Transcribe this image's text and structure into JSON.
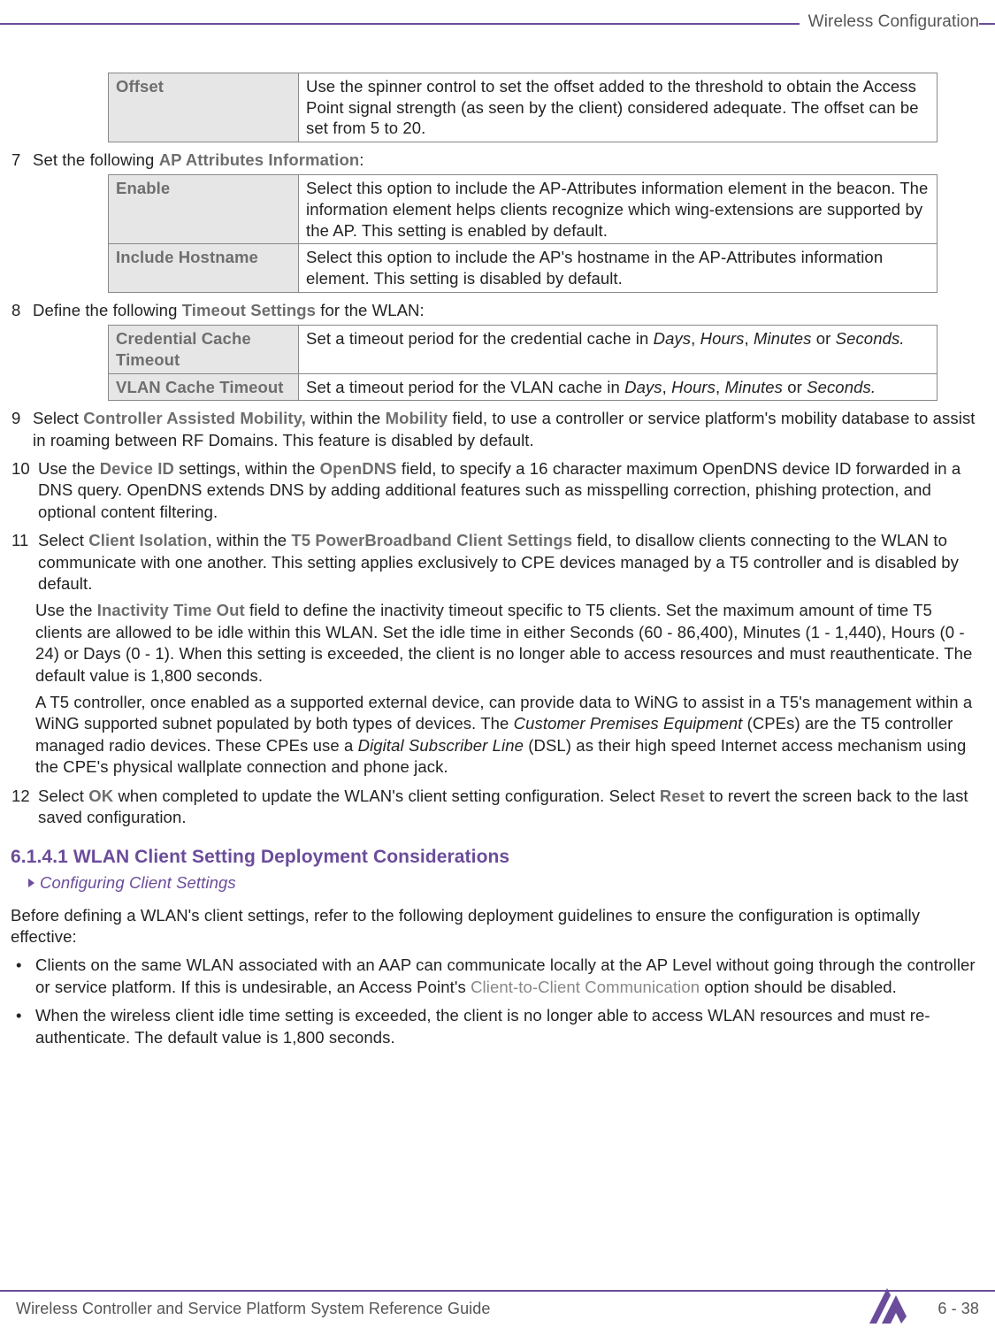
{
  "header": {
    "title": "Wireless Configuration"
  },
  "table_offset": {
    "rows": [
      {
        "label": "Offset",
        "desc": "Use the spinner control to set the offset added to the threshold to obtain the Access Point signal strength (as seen by the client) considered adequate. The offset can be set from 5 to 20."
      }
    ]
  },
  "step7": {
    "num": "7",
    "intro_pre": "Set the following ",
    "intro_bold": "AP Attributes Information",
    "intro_post": ":"
  },
  "table_ap": {
    "rows": [
      {
        "label": "Enable",
        "desc": "Select this option to include the AP-Attributes information element in the beacon. The information element helps clients recognize which wing-extensions are supported by the AP. This setting is enabled by default."
      },
      {
        "label": "Include Hostname",
        "desc": "Select this option to include the AP's hostname in the AP-Attributes information element. This setting is disabled by default."
      }
    ]
  },
  "step8": {
    "num": "8",
    "intro_pre": "Define the following ",
    "intro_bold": "Timeout Settings",
    "intro_post": " for the WLAN:"
  },
  "table_timeout": {
    "rows": [
      {
        "label": "Credential Cache Timeout",
        "desc_pre": "Set a timeout period for the credential cache in ",
        "i1": "Days",
        "s1": ", ",
        "i2": "Hours",
        "s2": ", ",
        "i3": "Minutes",
        "s3": " or ",
        "i4": "Seconds."
      },
      {
        "label": "VLAN Cache Timeout",
        "desc_pre": "Set a timeout period for the VLAN cache in ",
        "i1": "Days",
        "s1": ", ",
        "i2": "Hours",
        "s2": ", ",
        "i3": "Minutes",
        "s3": " or ",
        "i4": "Seconds."
      }
    ]
  },
  "step9": {
    "num": "9",
    "p1": "Select ",
    "b1": "Controller Assisted Mobility,",
    "p2": " within the ",
    "b2": "Mobility",
    "p3": " field, to use a controller or service platform's mobility database to assist in roaming between RF Domains. This feature is disabled by default."
  },
  "step10": {
    "num": "10",
    "p1": "Use the ",
    "b1": "Device ID",
    "p2": " settings, within the ",
    "b2": "OpenDNS",
    "p3": " field, to specify a 16 character maximum OpenDNS device ID forwarded in a DNS query. OpenDNS extends DNS by adding additional features such as misspelling correction, phishing protection, and optional content filtering."
  },
  "step11": {
    "num": "11",
    "p1": "Select ",
    "b1": "Client Isolation",
    "p2": ", within the ",
    "b2": "T5 PowerBroadband Client Settings",
    "p3": " field, to disallow clients connecting to the WLAN to communicate with one another. This setting applies exclusively to CPE devices managed by a T5 controller and is disabled by default.",
    "sub1_pre": "Use the ",
    "sub1_b": "Inactivity Time Out",
    "sub1_post": " field to define the inactivity timeout specific to T5 clients. Set the maximum amount of time T5 clients are allowed to be idle within this WLAN. Set the idle time in either Seconds (60 - 86,400), Minutes (1 - 1,440), Hours (0 - 24) or Days (0 - 1). When this setting is exceeded, the client is no longer able to access resources and must reauthenticate. The default value is 1,800 seconds.",
    "sub2_p1": "A T5 controller, once enabled as a supported external device, can provide data to WiNG to assist in a T5's management within a WiNG supported subnet populated by both types of devices. The ",
    "sub2_i1": "Customer Premises Equipment",
    "sub2_p2": " (CPEs) are the T5 controller managed radio devices. These CPEs use a ",
    "sub2_i2": "Digital Subscriber Line",
    "sub2_p3": " (DSL) as their high speed Internet access mechanism using the CPE's physical wallplate connection and phone jack."
  },
  "step12": {
    "num": "12",
    "p1": "Select ",
    "b1": "OK",
    "p2": " when completed to update the WLAN's client setting configuration. Select ",
    "b2": "Reset",
    "p3": " to revert the screen back to the last saved configuration."
  },
  "section_heading": "6.1.4.1 WLAN Client Setting Deployment Considerations",
  "breadcrumb": "Configuring Client Settings",
  "before_para": "Before defining a WLAN's client settings, refer to the following deployment guidelines to ensure the configuration is optimally effective:",
  "bullets": [
    {
      "p1": "Clients on the same WLAN associated with an AAP can communicate locally at the AP Level without going through the controller or service platform. If this is undesirable, an Access Point's ",
      "link": "Client-to-Client Communication",
      "p2": " option should be disabled."
    },
    {
      "p1": "When the wireless client idle time setting is exceeded, the client is no longer able to access WLAN resources and must re-authenticate. The default value is 1,800 seconds.",
      "link": "",
      "p2": ""
    }
  ],
  "footer": {
    "left": "Wireless Controller and Service Platform System Reference Guide",
    "right": "6 - 38"
  }
}
